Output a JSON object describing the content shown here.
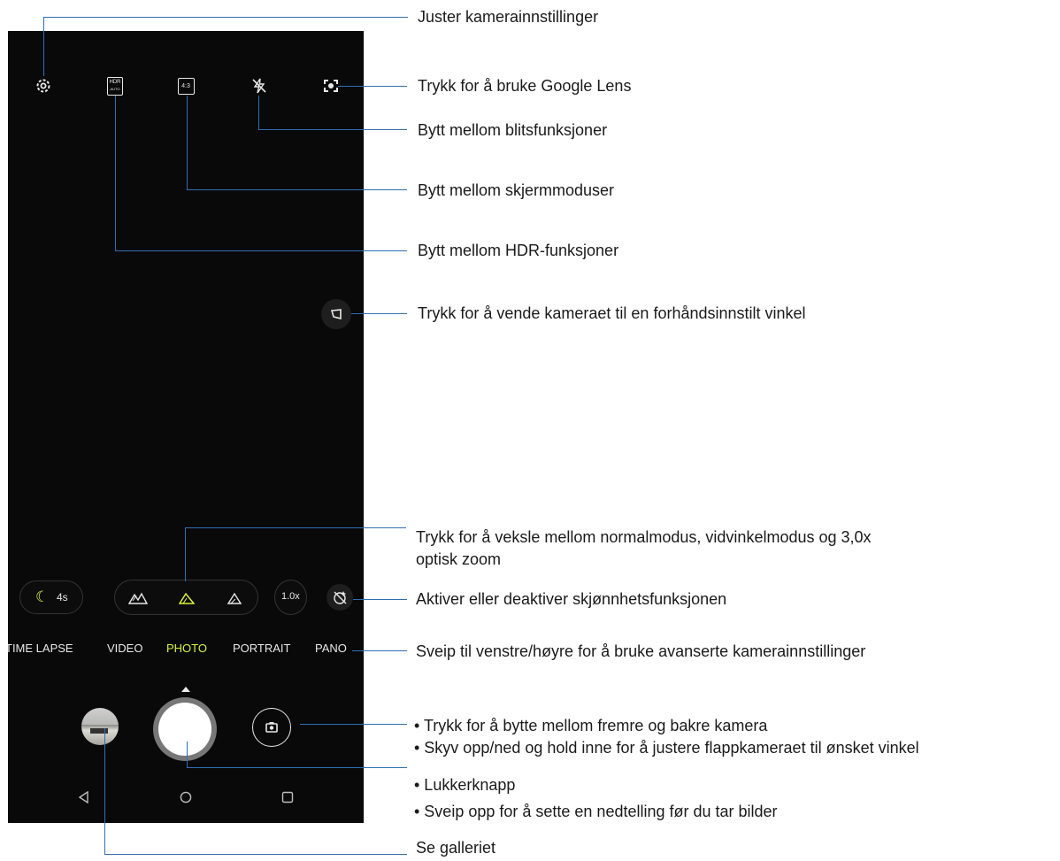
{
  "camera": {
    "top_icons": [
      "gear-icon",
      "hdr-auto-icon",
      "aspect-ratio-icon",
      "flash-off-icon",
      "google-lens-icon"
    ],
    "hdr_label_top": "HDR",
    "hdr_label_bottom": "AUTO",
    "aspect_label": "4:3",
    "night_timer": "4s",
    "zoom_label": "1.0x",
    "lens_buttons": [
      "ultrawide-icon",
      "normal-lens-icon",
      "telephoto-icon"
    ],
    "modes": [
      "TIME LAPSE",
      "VIDEO",
      "PHOTO",
      "PORTRAIT",
      "PANO"
    ],
    "active_mode": "PHOTO",
    "accent_color": "#d9f23a",
    "nav_buttons": [
      "back-icon",
      "home-icon",
      "recents-icon"
    ]
  },
  "annotations": {
    "settings": "Juster kamerainnstillinger",
    "lens": "Trykk for å bruke Google Lens",
    "flash": "Bytt mellom blitsfunksjoner",
    "screen_mode": "Bytt mellom skjermmoduser",
    "hdr": "Bytt mellom HDR-funksjoner",
    "flip_angle": "Trykk for å vende kameraet til en forhåndsinnstilt vinkel",
    "zoom_line1": "Trykk for å veksle mellom normalmodus, vidvinkelmodus og 3,0x",
    "zoom_line2": "optisk zoom",
    "beauty": "Aktiver eller deaktiver skjønnhetsfunksjonen",
    "swipe_modes": "Sveip til venstre/høyre for å bruke avanserte kamerainnstillinger",
    "switch_cam_1": "• Trykk for å bytte mellom fremre og bakre kamera",
    "switch_cam_2": "• Skyv opp/ned og hold inne for å justere flappkameraet til ønsket vinkel",
    "shutter_1": "•  Lukkerknapp",
    "shutter_2": "•  Sveip opp for å sette en nedtelling før du tar bilder",
    "gallery": "Se galleriet"
  }
}
